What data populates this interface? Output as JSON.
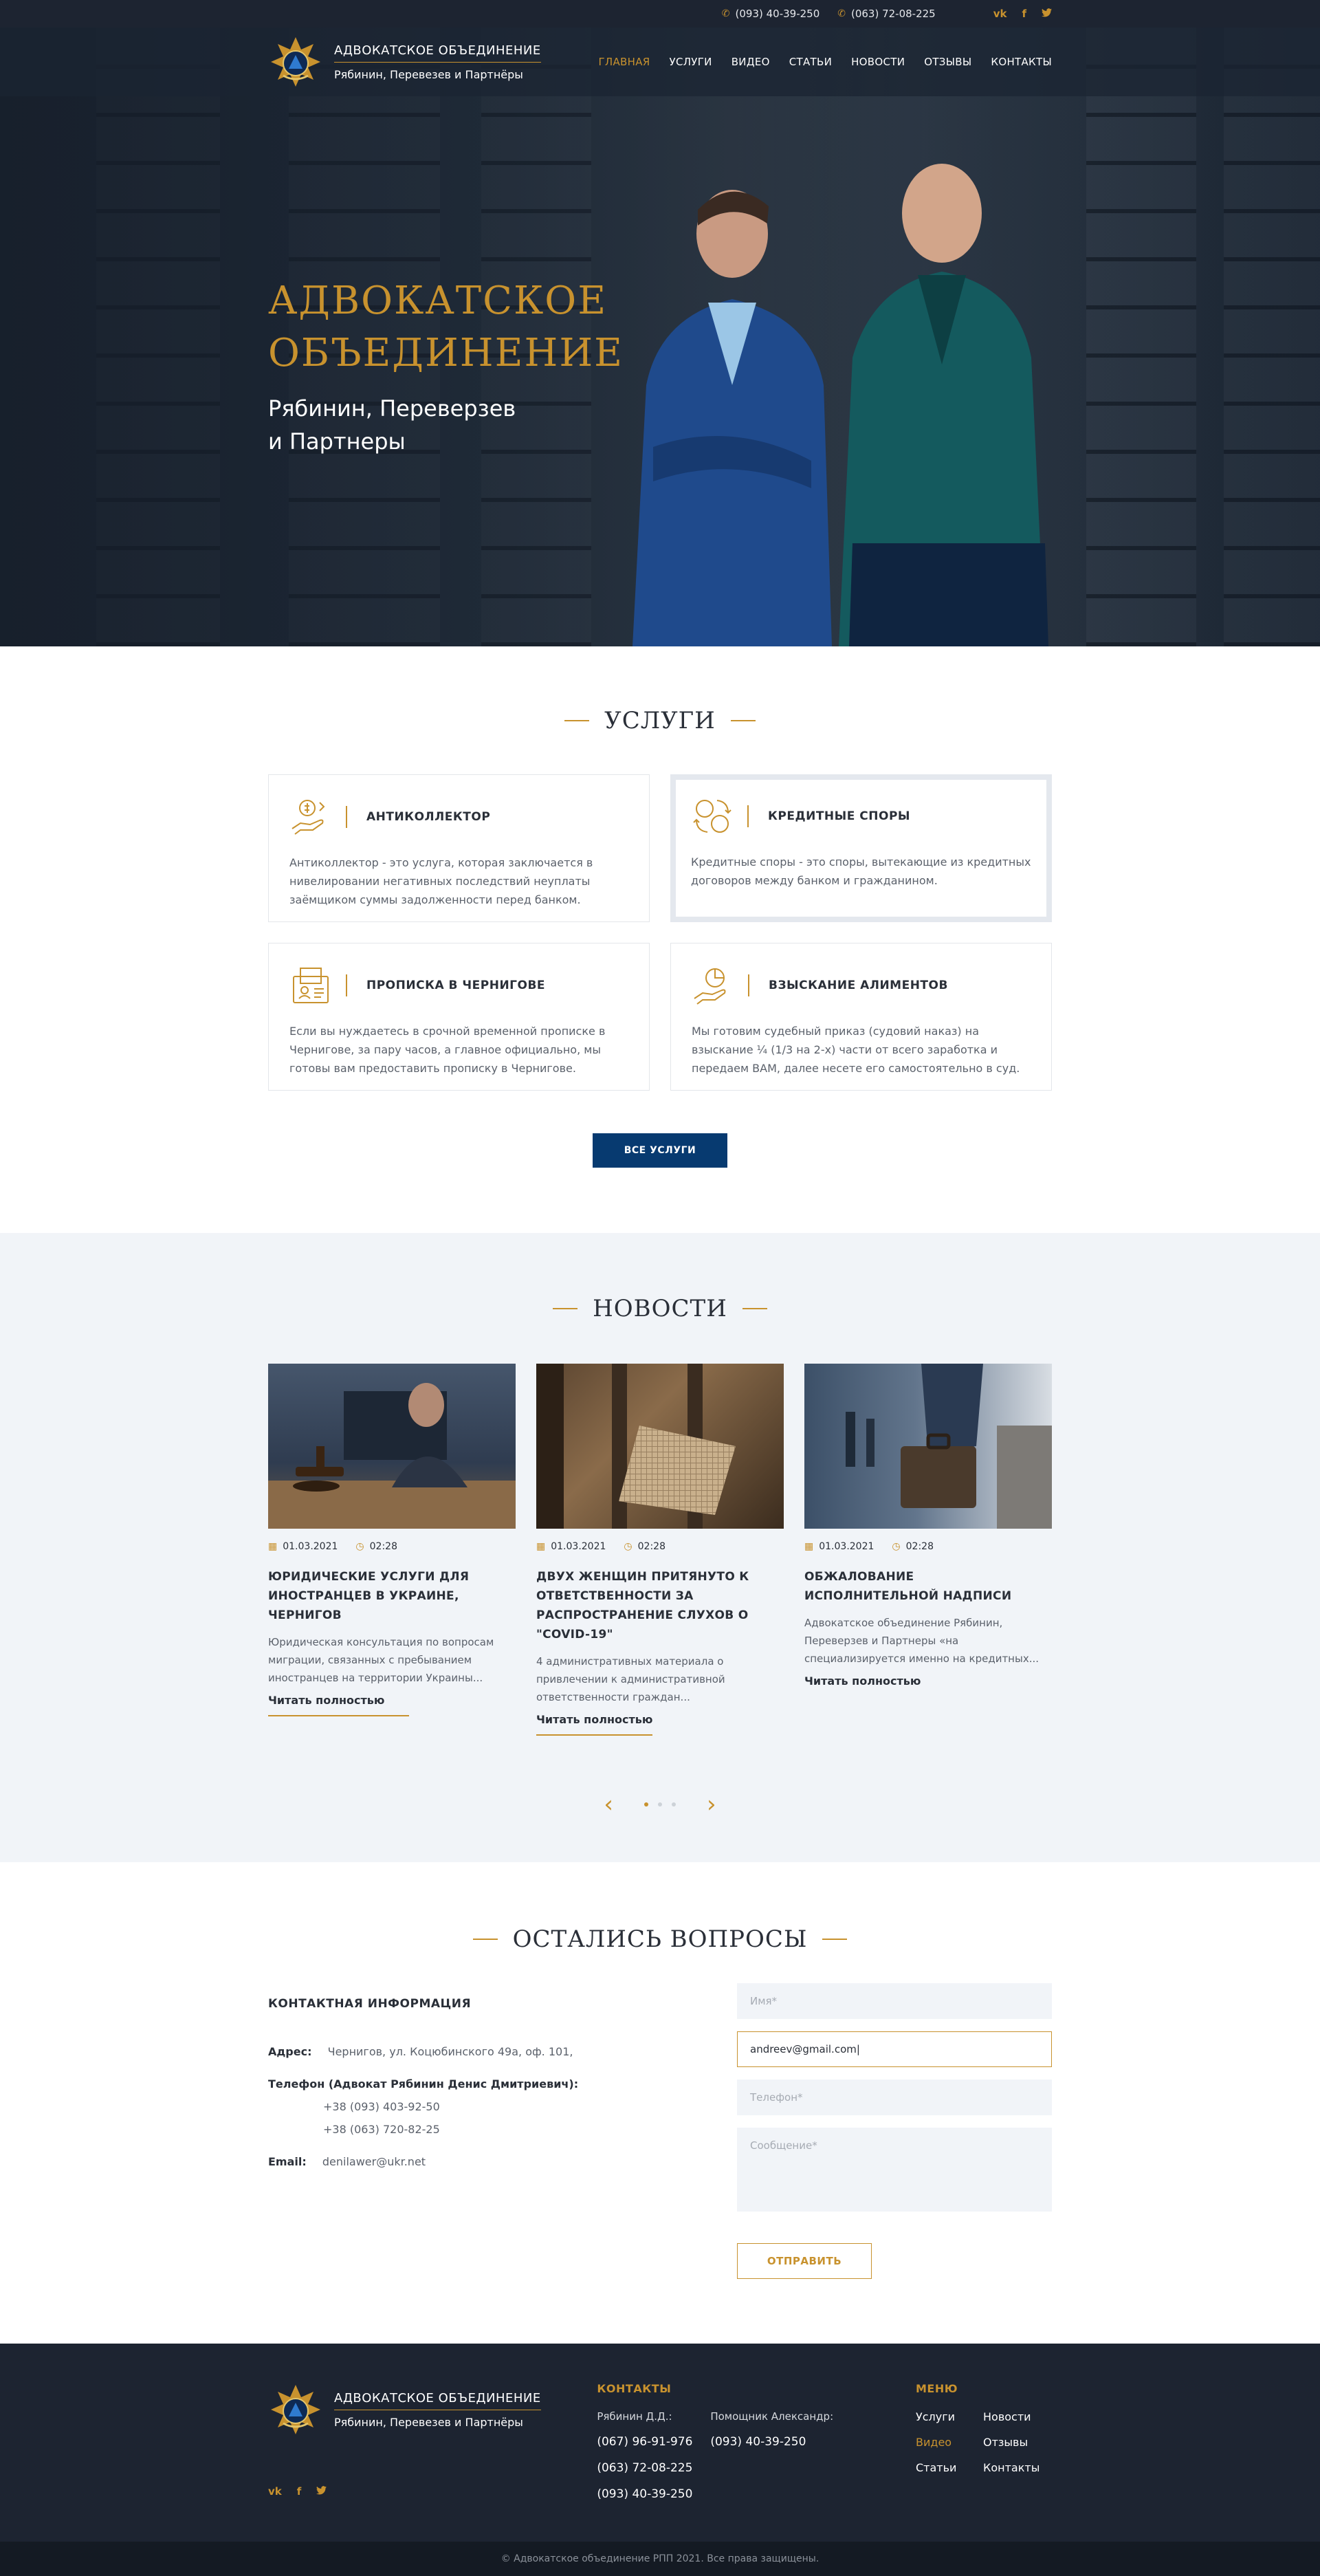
{
  "topbar": {
    "phones": [
      "(093) 40-39-250",
      "(063) 72-08-225"
    ],
    "socials": [
      "vk",
      "f",
      "twitter"
    ]
  },
  "brand": {
    "line1": "АДВОКАТСКОЕ ОБЪЕДИНЕНИЕ",
    "line2": "Рябинин, Перевезев и Партнёры"
  },
  "nav": {
    "items": [
      "ГЛАВНАЯ",
      "УСЛУГИ",
      "ВИДЕО",
      "СТАТЬИ",
      "НОВОСТИ",
      "ОТЗЫВЫ",
      "КОНТАКТЫ"
    ]
  },
  "hero": {
    "title_line1": "АДВОКАТСКОЕ",
    "title_line2": "ОБЪЕДИНЕНИЕ",
    "subtitle_line1": "Рябинин, Переверзев",
    "subtitle_line2": "и Партнеры"
  },
  "services": {
    "title": "УСЛУГИ",
    "items": [
      {
        "name": "АНТИКОЛЛЕКТОР",
        "desc": "Антиколлектор - это услуга, которая заключается в нивелировании негативных последствий неуплаты заёмщиком суммы задолженности перед банком."
      },
      {
        "name": "КРЕДИТНЫЕ СПОРЫ",
        "desc": "Кредитные споры - это споры, вытекающие из кредитных договоров между банком и гражданином."
      },
      {
        "name": "ПРОПИСКА В ЧЕРНИГОВЕ",
        "desc": "Если вы нуждаетесь в срочной временной прописке в Чернигове, за пару часов, а главное официально, мы готовы вам предоставить прописку в Чернигове."
      },
      {
        "name": "ВЗЫСКАНИЕ АЛИМЕНТОВ",
        "desc": "Мы готовим судебный приказ (судовий наказ) на взыскание ¼ (1/3 на 2-х) части от всего заработка и передаем ВАМ, далее несете его самостоятельно в суд."
      }
    ],
    "button": "ВСЕ УСЛУГИ"
  },
  "news": {
    "title": "НОВОСТИ",
    "items": [
      {
        "date": "01.03.2021",
        "time": "02:28",
        "title": "ЮРИДИЧЕСКИЕ УСЛУГИ ДЛЯ ИНОСТРАНЦЕВ В УКРАИНЕ, ЧЕРНИГОВ",
        "text": "Юридическая консультация по вопросам миграции, связанных с пребыванием иностранцев на территории Украины...",
        "more": "Читать полностью"
      },
      {
        "date": "01.03.2021",
        "time": "02:28",
        "title": "ДВУХ ЖЕНЩИН ПРИТЯНУТО К ОТВЕТСТВЕННОСТИ ЗА РАСПРОСТРАНЕНИЕ СЛУХОВ О \"COVID-19\"",
        "text": "4 административных материала о привлечении к административной ответственности граждан...",
        "more": "Читать полностью"
      },
      {
        "date": "01.03.2021",
        "time": "02:28",
        "title": "ОБЖАЛОВАНИЕ ИСПОЛНИТЕЛЬНОЙ НАДПИСИ",
        "text": "Адвокатское объединение Рябинин, Переверзев и Партнеры «на специализируется именно на кредитных...",
        "more": "Читать полностью"
      }
    ]
  },
  "contacts": {
    "title": "ОСТАЛИСЬ ВОПРОСЫ",
    "info_heading": "КОНТАКТНАЯ ИНФОРМАЦИЯ",
    "address_label": "Адрес:",
    "address": "Чернигов, ул. Коцюбинского 49а, оф. 101,",
    "phone_label": "Телефон (Адвокат Рябинин Денис Дмитриевич):",
    "phone1": "+38 (093) 403-92-50",
    "phone2": "+38 (063) 720-82-25",
    "email_label": "Email:",
    "email": "denilawer@ukr.net",
    "form": {
      "name_placeholder": "Имя*",
      "email_value": "andreev@gmail.com|",
      "phone_placeholder": "Телефон*",
      "message_placeholder": "Сообщение*",
      "submit": "ОТПРАВИТЬ"
    }
  },
  "footer": {
    "contacts_title": "КОНТАКТЫ",
    "person1_name": "Рябинин Д.Д.:",
    "person1_phones": [
      "(067) 96-91-976",
      "(063) 72-08-225",
      "(093) 40-39-250"
    ],
    "person2_name": "Помощник Александр:",
    "person2_phones": [
      "(093) 40-39-250"
    ],
    "menu_title": "МЕНЮ",
    "menu": [
      "Услуги",
      "Новости",
      "Видео",
      "Отзывы",
      "Статьи",
      "Контакты"
    ],
    "copyright": "© Адвокатское объединение РПП 2021. Все права защищены."
  },
  "colors": {
    "accent": "#c8922e",
    "dark": "#1d2431",
    "primary_button": "#073a70",
    "section_bg": "#f1f4f8"
  }
}
